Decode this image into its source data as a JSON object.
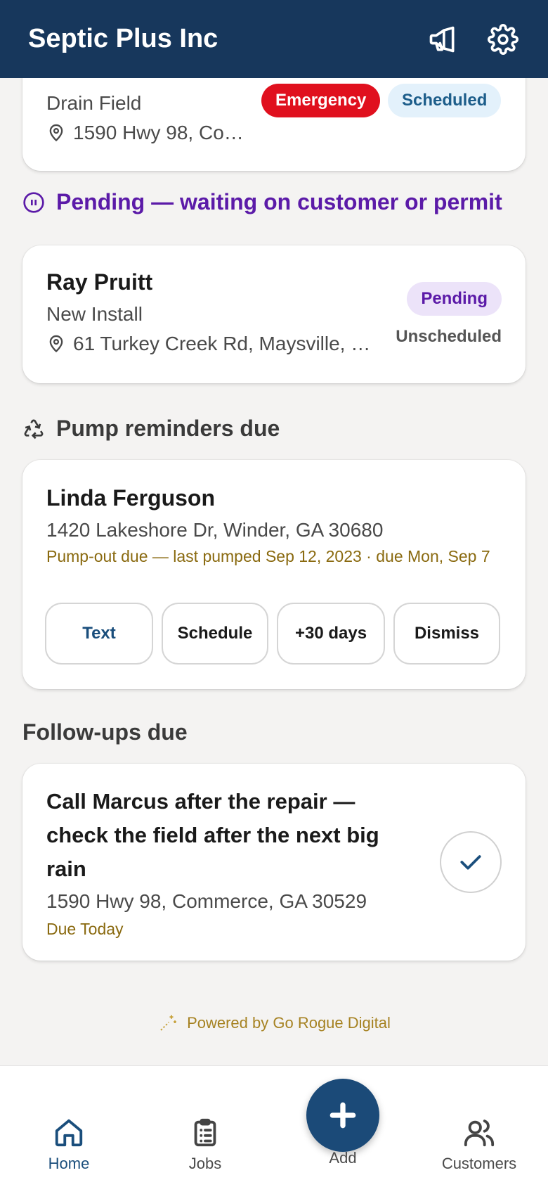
{
  "header": {
    "title": "Septic Plus Inc",
    "announce_icon": "megaphone-icon",
    "settings_icon": "gear-icon"
  },
  "top_card": {
    "service": "Drain Field",
    "address": "1590 Hwy 98, Co…",
    "badges": [
      {
        "label": "Emergency",
        "bg": "#e0101e",
        "fg": "#ffffff"
      },
      {
        "label": "Scheduled",
        "bg": "#e3f1fb",
        "fg": "#1c5d8a"
      }
    ]
  },
  "pending_section": {
    "title": "Pending — waiting on customer or permit",
    "color": "#5b1aa8",
    "card": {
      "name": "Ray Pruitt",
      "service": "New Install",
      "address": "61 Turkey Creek Rd, Maysville, …",
      "badge": "Pending",
      "status": "Unscheduled"
    }
  },
  "pump_section": {
    "title": "Pump reminders due",
    "card": {
      "name": "Linda Ferguson",
      "address": "1420 Lakeshore Dr, Winder, GA 30680",
      "note": "Pump-out due — last pumped Sep 12, 2023 · due Mon, Sep 7",
      "actions": [
        "Text",
        "Schedule",
        "+30 days",
        "Dismiss"
      ]
    }
  },
  "followups_section": {
    "title": "Follow-ups due",
    "card": {
      "title": "Call Marcus after the repair — check the field after the next big rain",
      "address": "1590 Hwy 98, Commerce, GA 30529",
      "due": "Due Today"
    }
  },
  "footer": {
    "text": "Powered by Go Rogue Digital"
  },
  "bottom_nav": {
    "items": [
      {
        "label": "Home",
        "icon": "home-icon",
        "active": true
      },
      {
        "label": "Jobs",
        "icon": "clipboard-icon",
        "active": false
      },
      {
        "label": "Add",
        "icon": "plus-icon",
        "active": false
      },
      {
        "label": "Customers",
        "icon": "users-icon",
        "active": false
      }
    ]
  },
  "colors": {
    "brand": "#17375c",
    "accent": "#1b4a78",
    "due": "#8a6a10"
  }
}
